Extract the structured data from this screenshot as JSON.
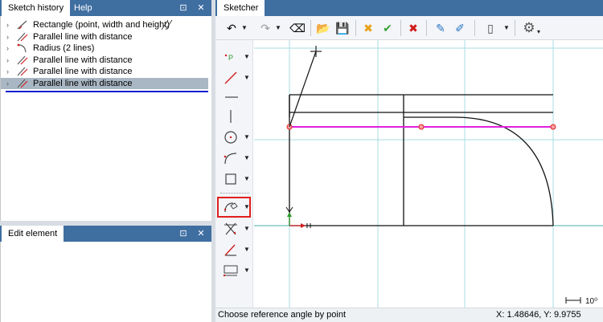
{
  "history_panel": {
    "tabs": [
      {
        "label": "Sketch history",
        "active": true
      },
      {
        "label": "Help",
        "active": false
      }
    ],
    "items": [
      {
        "label": "Rectangle (point, width and height)",
        "icon": "rectangle-icon",
        "selected": false
      },
      {
        "label": "Parallel line with distance",
        "icon": "parallel-line-icon",
        "selected": false
      },
      {
        "label": "Radius (2 lines)",
        "icon": "radius-icon",
        "selected": false
      },
      {
        "label": "Parallel line with distance",
        "icon": "parallel-line-icon",
        "selected": false
      },
      {
        "label": "Parallel line with distance",
        "icon": "parallel-line-icon",
        "selected": false
      },
      {
        "label": "Parallel line with distance",
        "icon": "parallel-line-icon",
        "selected": true
      }
    ],
    "pin_glyph": "⊡",
    "close_glyph": "✕"
  },
  "edit_panel": {
    "tab_label": "Edit element"
  },
  "sketcher": {
    "tab_label": "Sketcher",
    "toolbar": [
      {
        "icon": "undo-icon",
        "glyph": "↶",
        "dropdown": true
      },
      {
        "icon": "redo-icon",
        "glyph": "↷",
        "dropdown": true
      },
      {
        "icon": "clear-icon",
        "glyph": "⌫",
        "dropdown": false
      },
      {
        "icon": "open-folder-icon",
        "glyph": "📂",
        "dropdown": false
      },
      {
        "icon": "save-icon",
        "glyph": "💾",
        "dropdown": false
      },
      {
        "icon": "cancel-selection-icon",
        "glyph": "✖",
        "dropdown": false
      },
      {
        "icon": "accept-icon",
        "glyph": "✔",
        "dropdown": false
      },
      {
        "icon": "delete-icon",
        "glyph": "✖",
        "dropdown": false
      },
      {
        "icon": "eraser-icon",
        "glyph": "✎",
        "dropdown": false
      },
      {
        "icon": "edit-eraser-icon",
        "glyph": "✐",
        "dropdown": false
      },
      {
        "icon": "book-icon",
        "glyph": "▯",
        "dropdown": true
      },
      {
        "icon": "settings-gear-icon",
        "glyph": "⚙",
        "dropdown": false
      }
    ],
    "status_message": "Choose reference angle by point",
    "coordinates": "X: 1.48646, Y: 9.9755",
    "scale_label": "10⁰",
    "colors": {
      "accent": "#3f6ea1",
      "highlight_line": "#e020e0",
      "grid": "#a8dde0",
      "active_tool_border": "#e0201e",
      "selection_underline": "#0a1ed0"
    }
  }
}
